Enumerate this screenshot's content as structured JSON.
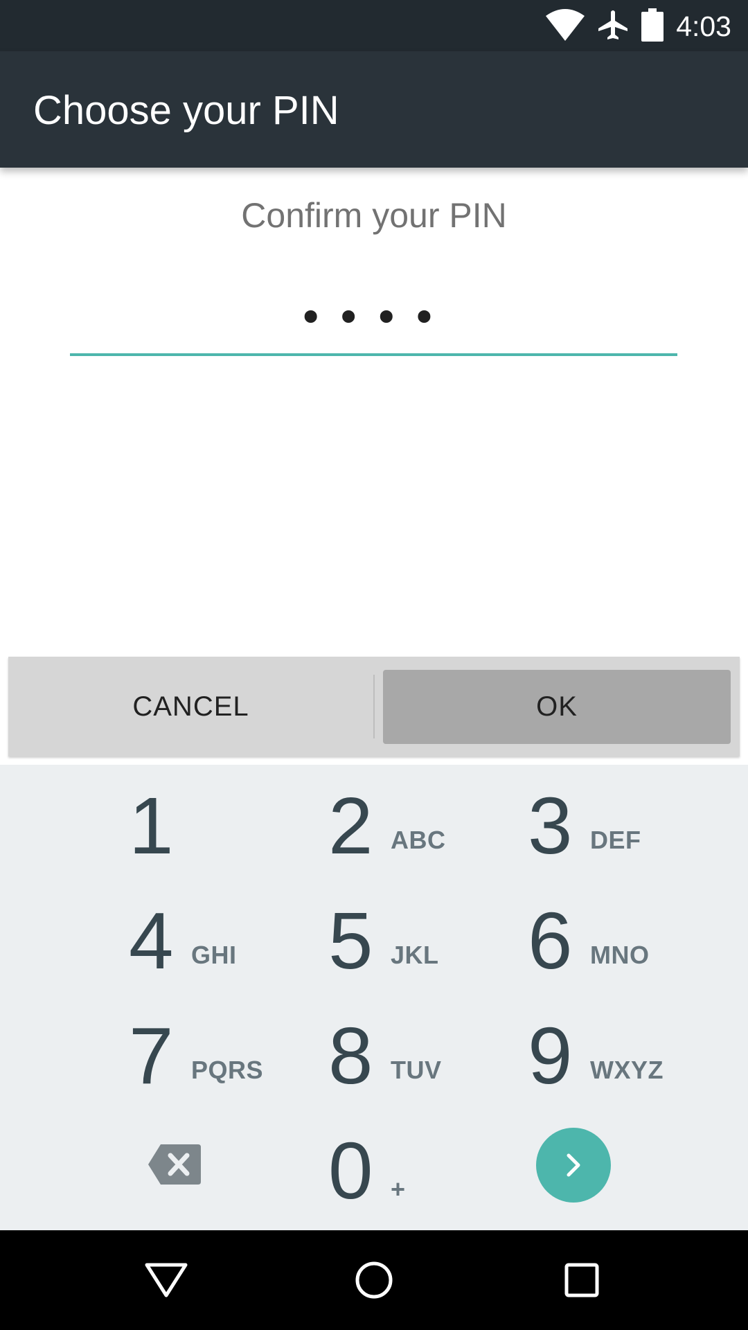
{
  "status_bar": {
    "time": "4:03",
    "icons": [
      "wifi-icon",
      "airplane-mode-icon",
      "battery-icon"
    ]
  },
  "app_bar": {
    "title": "Choose your PIN"
  },
  "pin_entry": {
    "label": "Confirm your PIN",
    "masked_value": "••••"
  },
  "buttons": {
    "cancel": "CANCEL",
    "ok": "OK"
  },
  "keypad": {
    "keys": [
      {
        "digit": "1",
        "letters": ""
      },
      {
        "digit": "2",
        "letters": "ABC"
      },
      {
        "digit": "3",
        "letters": "DEF"
      },
      {
        "digit": "4",
        "letters": "GHI"
      },
      {
        "digit": "5",
        "letters": "JKL"
      },
      {
        "digit": "6",
        "letters": "MNO"
      },
      {
        "digit": "7",
        "letters": "PQRS"
      },
      {
        "digit": "8",
        "letters": "TUV"
      },
      {
        "digit": "9",
        "letters": "WXYZ"
      },
      {
        "digit": "0",
        "letters": "+"
      }
    ],
    "backspace_icon": "backspace-icon",
    "enter_icon": "chevron-right-icon"
  },
  "nav_bar": {
    "icons": [
      "back-triangle-icon",
      "home-circle-icon",
      "recents-square-icon"
    ]
  },
  "colors": {
    "status_bar": "#222a30",
    "app_bar": "#2a333a",
    "accent": "#4db6ac",
    "keypad_bg": "#eceff1",
    "digit": "#37474f",
    "ok_button": "#a8a8a8",
    "button_bar": "#d6d6d6"
  }
}
